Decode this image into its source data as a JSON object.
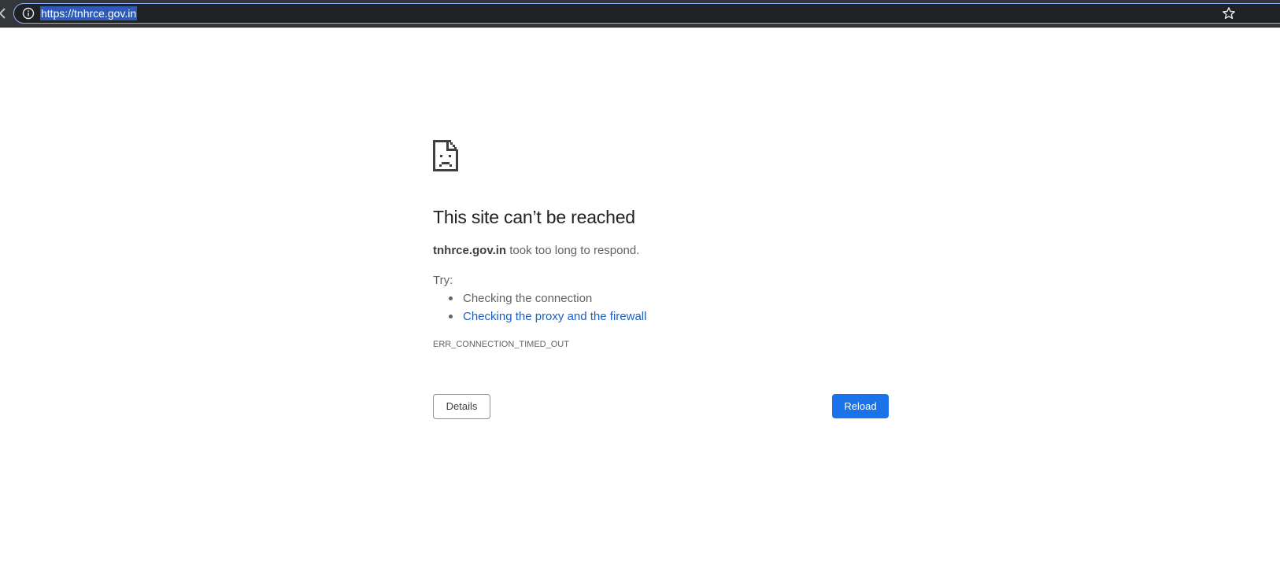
{
  "browser": {
    "url": "https://tnhrce.gov.in",
    "icons": {
      "site_info": "info-icon",
      "bookmark": "star-icon",
      "back": "chevron-left-icon"
    },
    "colors": {
      "toolbar": "#35363a",
      "omnibox": "#202124",
      "url_highlight": "#2f5bb7"
    }
  },
  "error_page": {
    "icon": "sad-document-icon",
    "title": "This site can’t be reached",
    "summary": {
      "host": "tnhrce.gov.in",
      "message": " took too long to respond."
    },
    "try_label": "Try:",
    "suggestions": [
      {
        "text": "Checking the connection",
        "is_link": false
      },
      {
        "text": "Checking the proxy and the firewall",
        "is_link": true
      }
    ],
    "error_code": "ERR_CONNECTION_TIMED_OUT",
    "buttons": {
      "details": "Details",
      "reload": "Reload"
    },
    "colors": {
      "link": "#1a5fc0",
      "primary_button": "#1a73e8"
    }
  }
}
